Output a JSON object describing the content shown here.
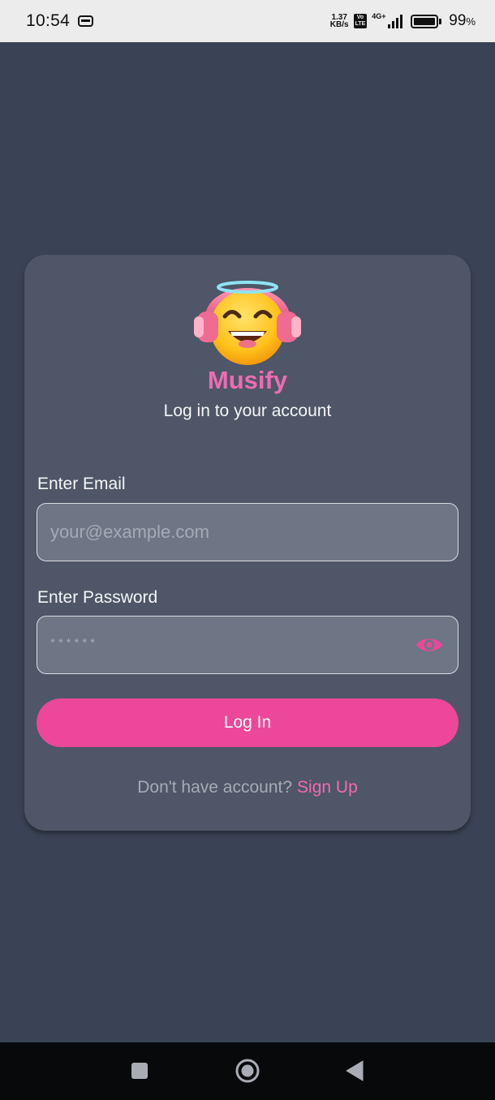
{
  "status_bar": {
    "time": "10:54",
    "net_speed_value": "1.37",
    "net_speed_unit": "KB/s",
    "volte_top": "Vo",
    "volte_bottom": "LTE",
    "network_type": "4G+",
    "battery_percent": "99",
    "battery_unit": "%",
    "battery_level": 0.99
  },
  "login": {
    "app_name": "Musify",
    "subtitle": "Log in to your account",
    "email": {
      "label": "Enter Email",
      "placeholder": "your@example.com",
      "value": ""
    },
    "password": {
      "label": "Enter Password",
      "placeholder": "******",
      "value": ""
    },
    "login_button": "Log In",
    "signup_prompt": "Don't have account?",
    "signup_link": "Sign Up"
  },
  "icons": {
    "logo": "headphones-emoji-icon",
    "password_toggle": "eye-icon",
    "nav_recents": "square-icon",
    "nav_home": "circle-icon",
    "nav_back": "triangle-back-icon"
  },
  "colors": {
    "background": "#3a4355",
    "card": "#4e5667",
    "input": "#6e7585",
    "accent": "#ec4799",
    "accent_text": "#f06bb3"
  }
}
